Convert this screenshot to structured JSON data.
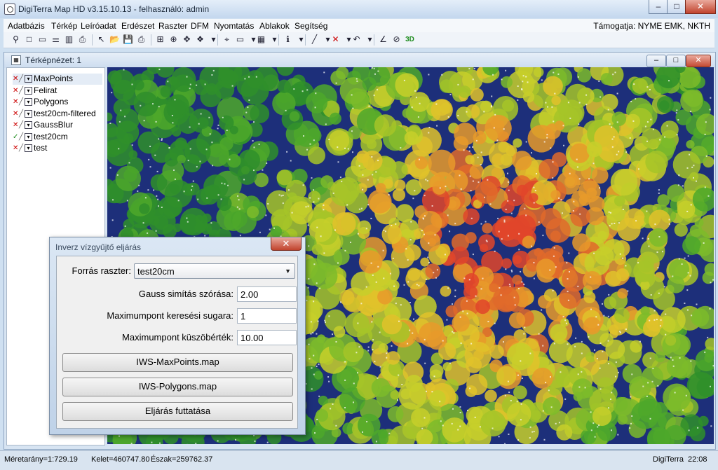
{
  "window": {
    "title": "DigiTerra Map HD v3.15.10.13 - felhasználó: admin",
    "minimize": "–",
    "maximize": "□",
    "close": "✕"
  },
  "menu": {
    "items": [
      "Adatbázis",
      "Térkép",
      "Leíróadat",
      "Erdészet",
      "Raszter",
      "DFM",
      "Nyomtatás",
      "Ablakok",
      "Segítség"
    ],
    "support": "Támogatja: NYME EMK, NKTH"
  },
  "toolbar": {
    "icons": [
      "binoculars-icon",
      "new-icon",
      "windows-icon",
      "layers-icon",
      "chart-icon",
      "preview-icon",
      "cursor-icon",
      "open-icon",
      "save-icon",
      "print-icon",
      "zoom-window-icon",
      "zoom-in-icon",
      "pan-icon",
      "layer-stack-icon",
      "dropdown-icon",
      "measure-icon",
      "select-icon",
      "dropdown-icon",
      "table-icon",
      "dropdown-icon",
      "info-icon",
      "dropdown-icon",
      "line-icon",
      "dropdown-icon",
      "delete-icon",
      "dropdown-icon",
      "undo-icon",
      "dropdown-icon",
      "angle-icon",
      "compass-icon",
      "3d-icon"
    ],
    "glyphs": [
      "⚲",
      "□",
      "▭",
      "⚌",
      "▥",
      "⎙",
      "↖",
      "📂",
      "💾",
      "⎙",
      "⊞",
      "⊕",
      "✥",
      "❖",
      "▾",
      "⌖",
      "▭",
      "▾",
      "▦",
      "▾",
      "ℹ",
      "▾",
      "╱",
      "▾",
      "✕",
      "▾",
      "↶",
      "▾",
      "∠",
      "⊘",
      "3D"
    ],
    "label_3d": "3D"
  },
  "mapview": {
    "title": "Térképnézet: 1",
    "layers": [
      {
        "name": "MaxPoints",
        "visible": false
      },
      {
        "name": "Felirat",
        "visible": false
      },
      {
        "name": "Polygons",
        "visible": false
      },
      {
        "name": "test20cm-filtered",
        "visible": false
      },
      {
        "name": "GaussBlur",
        "visible": false
      },
      {
        "name": "test20cm",
        "visible": true
      },
      {
        "name": "test",
        "visible": false
      }
    ]
  },
  "dialog": {
    "title": "Inverz vízgyűjtő eljárás",
    "source_label": "Forrás raszter:",
    "source_value": "test20cm",
    "gauss_label": "Gauss simítás szórása:",
    "gauss_value": "2.00",
    "radius_label": "Maximumpont keresési sugara:",
    "radius_value": "1",
    "threshold_label": "Maximumpont küszöbérték:",
    "threshold_value": "10.00",
    "btn_maxpoints": "IWS-MaxPoints.map",
    "btn_polygons": "IWS-Polygons.map",
    "btn_run": "Eljárás futtatása"
  },
  "statusbar": {
    "scale": "Méretarány=1:729.19",
    "east": "Kelet=460747.80",
    "north": "Észak=259762.37",
    "brand": "DigiTerra",
    "time": "22:08"
  }
}
